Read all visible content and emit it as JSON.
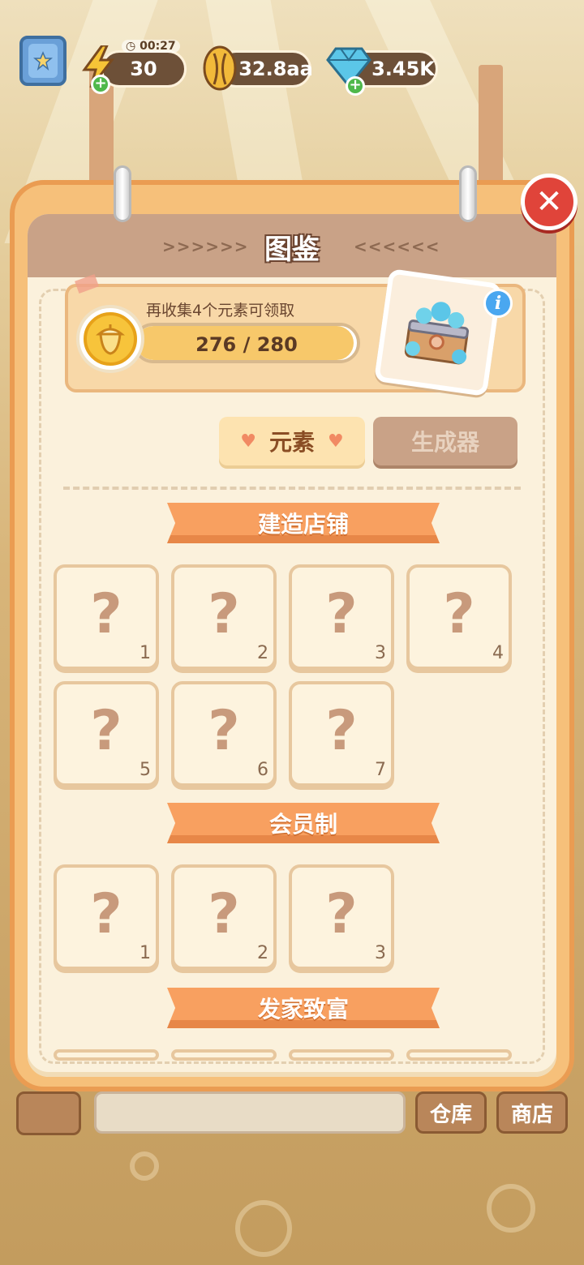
{
  "hud": {
    "energy_timer": "00:27",
    "energy": "30",
    "seeds": "32.8aa",
    "gems": "3.45K"
  },
  "panel": {
    "title": "图鉴",
    "left_arrows": ">>>>>>",
    "right_arrows": "<<<<<<",
    "progress": {
      "hint": "再收集4个元素可领取",
      "label": "276 / 280",
      "current": 276,
      "total": 280
    },
    "tabs": [
      {
        "label": "元素",
        "active": true
      },
      {
        "label": "生成器",
        "active": false
      }
    ],
    "categories": [
      {
        "title": "建造店铺",
        "items": [
          "1",
          "2",
          "3",
          "4",
          "5",
          "6",
          "7"
        ]
      },
      {
        "title": "会员制",
        "items": [
          "1",
          "2",
          "3"
        ]
      },
      {
        "title": "发家致富",
        "items": []
      }
    ],
    "locked_symbol": "?"
  },
  "bottom_bar": {
    "warehouse": "仓库",
    "shop": "商店"
  },
  "colors": {
    "panel_frame": "#f6c07a",
    "panel_inner": "#fbf1dc",
    "ribbon": "#f8a060",
    "close": "#e0443a"
  }
}
